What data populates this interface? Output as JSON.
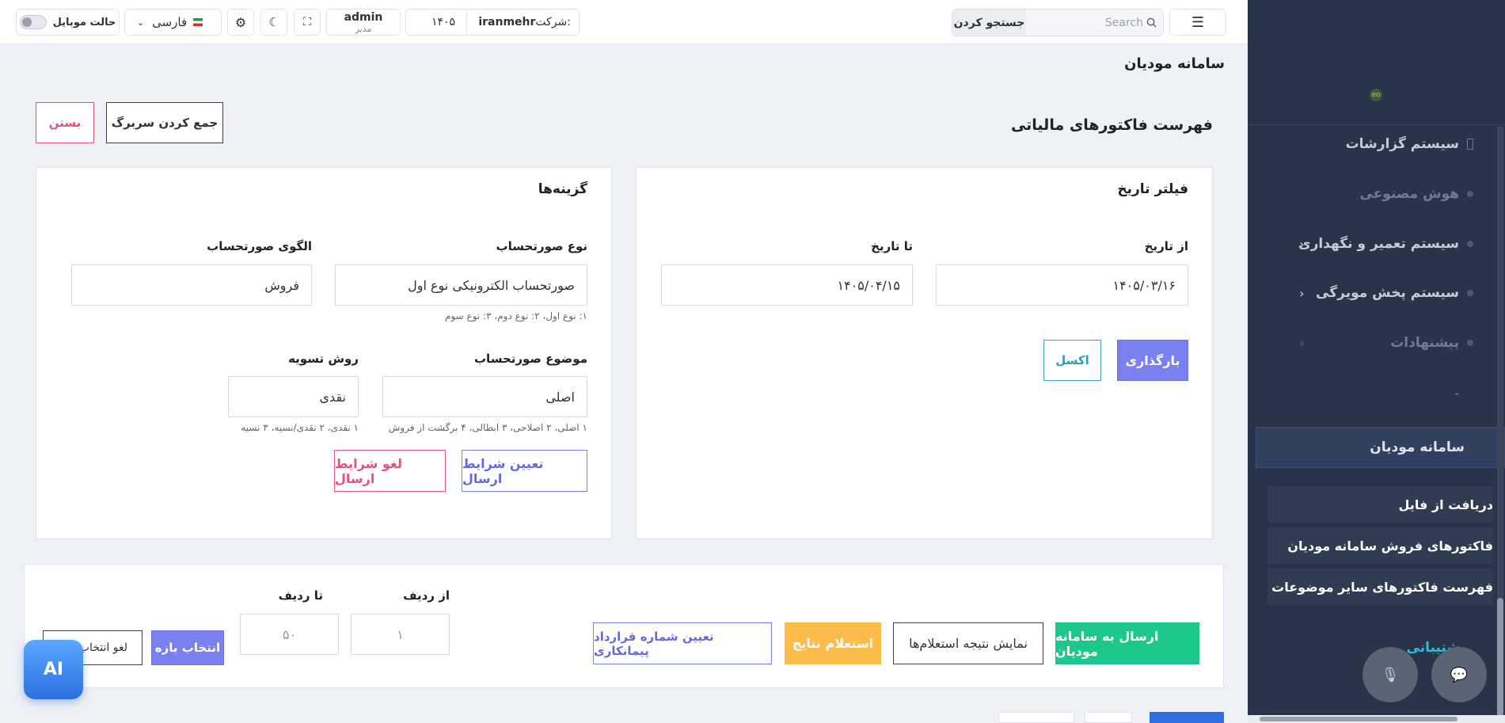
{
  "header": {
    "search_placeholder": "Search",
    "search_button": "جستجو کردن",
    "company_label": "شرکت:",
    "company_name": "iranmehr",
    "year": "۱۴۰۵",
    "user_name": "admin",
    "user_role": "مدیر",
    "language": "فارسی",
    "mobile_mode": "حالت موبایل"
  },
  "sidebar": {
    "logo": "eo",
    "items": [
      {
        "label": "سیستم گزارشات"
      },
      {
        "label": "هوش مصنوعی"
      },
      {
        "label": "سیستم تعمیر و نگهداری"
      },
      {
        "label": "سیستم پخش مویرگی"
      },
      {
        "label": "پیشنهادات"
      },
      {
        "label": "-"
      }
    ],
    "active": "سامانه مودیان",
    "subitems": [
      {
        "label": "دریافت از فایل"
      },
      {
        "label": "فاکتورهای فروش سامانه مودیان"
      },
      {
        "label": "فهرست فاکتورهای سایر موضوعات"
      }
    ],
    "support": "پشتیبانی"
  },
  "page": {
    "title": "سامانه مودیان",
    "card_title": "فهرست فاکتورهای مالیاتی",
    "collapse_header": "جمع کردن سربرگ",
    "close": "بستن"
  },
  "date_filter": {
    "title": "فیلتر تاریخ",
    "from_label": "از تاریخ",
    "from_value": "۱۴۰۵/۰۳/۱۶",
    "to_label": "تا تاریخ",
    "to_value": "۱۴۰۵/۰۴/۱۵",
    "load_button": "بارگذاری",
    "excel_button": "اکسل"
  },
  "options": {
    "title": "گزینه‌ها",
    "invoice_type_label": "نوع صورتحساب",
    "invoice_type_value": "صورتحساب الکترونیکی نوع اول",
    "invoice_type_hint": "۱: نوع اول، ۲: نوع دوم، ۳: نوع سوم",
    "pattern_label": "الگوی صورتحساب",
    "pattern_value": "فروش",
    "subject_label": "موضوع صورتحساب",
    "subject_value": "اصلی",
    "subject_hint": "۱ اصلی، ۲ اصلاحی، ۳ ابطالی، ۴ برگشت از فروش",
    "settlement_label": "روش تسویه",
    "settlement_value": "نقدی",
    "settlement_hint": "۱ نقدی، ۲ نقدی/نسیه، ۳ نسیه",
    "set_conditions": "تعیین شرایط ارسال",
    "cancel_conditions": "لغو شرایط ارسال"
  },
  "actions": {
    "send": "ارسال به سامانه مودیان",
    "show_results": "نمایش نتیجه استعلام‌ها",
    "inquiry": "استعلام نتایج",
    "contract": "تعیین شماره قرارداد پیمانکاری",
    "from_row_label": "از ردیف",
    "from_row_placeholder": "۱",
    "to_row_label": "تا ردیف",
    "to_row_placeholder": "۵۰",
    "select_range": "انتخاب بازه",
    "deselect": "لغو انتخاب"
  },
  "ai_label": "AI",
  "colors": {
    "primary": "#7b80f0",
    "success": "#1cc88a",
    "warning": "#fdbb4a",
    "danger": "#e8527a",
    "info": "#3aa7c2",
    "sidebar_bg": "#283448"
  }
}
